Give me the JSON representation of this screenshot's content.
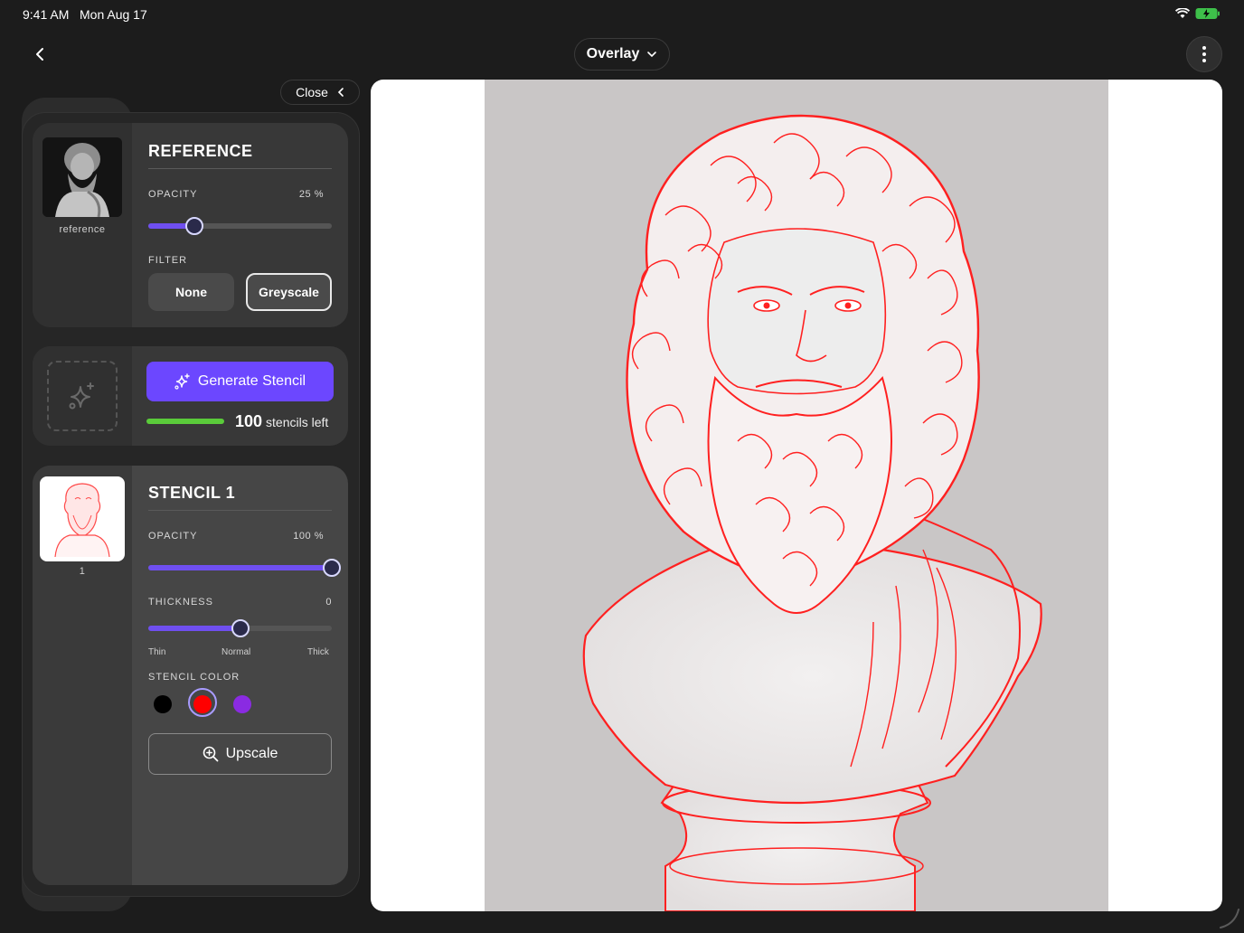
{
  "status_bar": {
    "time": "9:41 AM",
    "date": "Mon Aug 17"
  },
  "header": {
    "mode_label": "Overlay",
    "back_icon": "chevron-left-icon",
    "more_icon": "more-vertical-icon"
  },
  "panel": {
    "close_label": "Close"
  },
  "reference": {
    "title": "REFERENCE",
    "thumb_caption": "reference",
    "opacity_label": "OPACITY",
    "opacity_value": "25 %",
    "opacity": 0.25,
    "filter_label": "FILTER",
    "filters": [
      "None",
      "Greyscale"
    ],
    "selected_filter": "Greyscale"
  },
  "generate": {
    "button_label": "Generate Stencil",
    "credits_count": "100",
    "credits_text": "stencils left"
  },
  "stencil": {
    "title": "STENCIL 1",
    "thumb_caption": "1",
    "opacity_label": "OPACITY",
    "opacity_value": "100 %",
    "opacity": 1.0,
    "thickness_label": "THICKNESS",
    "thickness_value": "0",
    "thickness": 0.5,
    "thickness_ticks": [
      "Thin",
      "Normal",
      "Thick"
    ],
    "color_label": "STENCIL COLOR",
    "colors": [
      "#000000",
      "#ff0000",
      "#8a2be2"
    ],
    "selected_color": "#ff0000",
    "upscale_label": "Upscale"
  },
  "colors": {
    "accent": "#6c47ff",
    "credits": "#5acb3a",
    "stencil_line": "#ff2a2a"
  }
}
